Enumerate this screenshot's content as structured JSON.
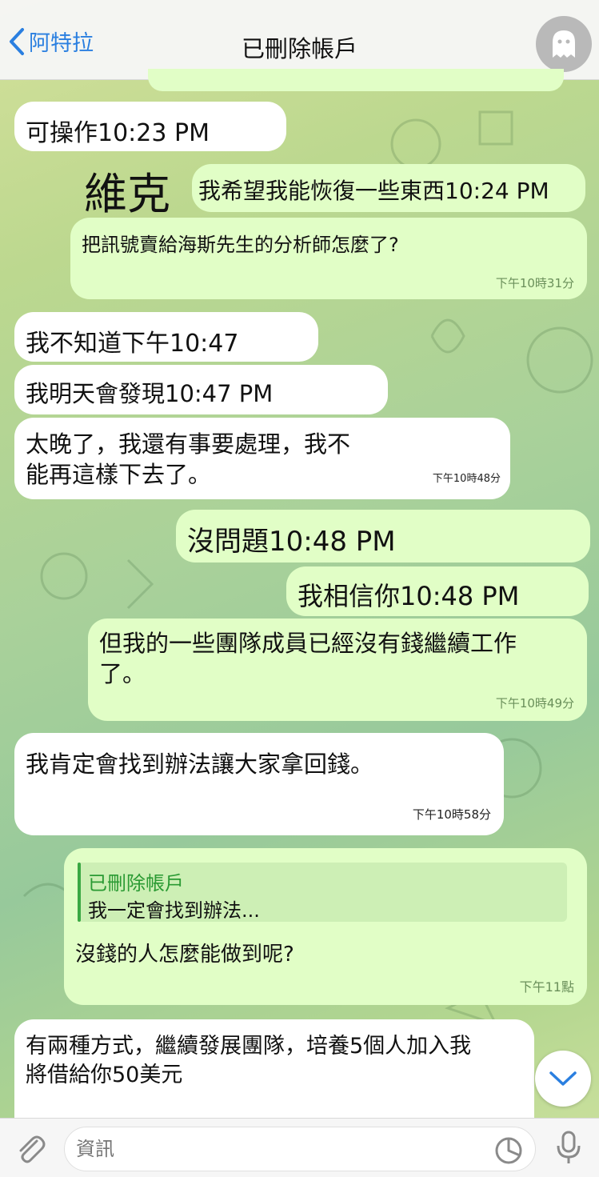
{
  "header": {
    "back_label": "阿特拉",
    "title": "已刪除帳戶",
    "avatar_icon": "ghost-icon"
  },
  "messages": [
    {
      "text": "可操作10:23 PM"
    },
    {
      "name_overlay": "維克",
      "text": "我希望我能恢復一些東西10:24 PM"
    },
    {
      "text": "把訊號賣給海斯先生的分析師怎麼了?",
      "time": "下午10時31分"
    },
    {
      "text": "我不知道下午10:47"
    },
    {
      "text": "我明天會發現10:47 PM"
    },
    {
      "text": "太晚了，我還有事要處理，我不\n能再這樣下去了。",
      "time": "下午10時48分"
    },
    {
      "text": "沒問題10:48 PM"
    },
    {
      "text": "我相信你10:48 PM"
    },
    {
      "text": "但我的一些團隊成員已經沒有錢繼續工作\n了。",
      "time": "下午10時49分"
    },
    {
      "text": "我肯定會找到辦法讓大家拿回錢。",
      "time": "下午10時58分"
    },
    {
      "reply_name": "已刪除帳戶",
      "reply_text": "我一定會找到辦法...",
      "text": "沒錢的人怎麼能做到呢?",
      "time": "下午11點"
    },
    {
      "text": "有兩種方式，繼續發展團隊，培養5個人加入我\n將借給你50美元"
    }
  ],
  "input": {
    "placeholder": "資訊"
  },
  "colors": {
    "outgoing": "#e1fec6",
    "incoming": "#ffffff",
    "accent": "#2a7fe0",
    "reply": "#2a9a33"
  }
}
